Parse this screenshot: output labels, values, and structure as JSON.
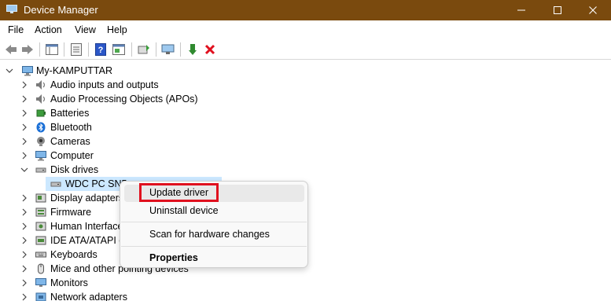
{
  "window": {
    "title": "Device Manager",
    "minimize_glyph": "—",
    "maximize_glyph": "☐",
    "close_glyph": "✕"
  },
  "menu": [
    "File",
    "Action",
    "View",
    "Help"
  ],
  "toolbar": {
    "icons": [
      "back-icon",
      "forward-icon",
      "console-tree-icon",
      "properties-icon",
      "help-icon",
      "action-pane-icon",
      "update-driver-icon",
      "scan-hardware-icon",
      "enable-device-icon",
      "uninstall-device-icon"
    ]
  },
  "tree": {
    "root": "My-KAMPUTTAR",
    "categories": [
      "Audio inputs and outputs",
      "Audio Processing Objects (APOs)",
      "Batteries",
      "Bluetooth",
      "Cameras",
      "Computer",
      "Disk drives"
    ],
    "disk_child": "WDC PC SN5",
    "more_categories": [
      "Display adapters",
      "Firmware",
      "Human Interface",
      "IDE ATA/ATAPI co",
      "Keyboards",
      "Mice and other pointing devices",
      "Monitors",
      "Network adapters"
    ]
  },
  "context_menu": {
    "items": [
      "Update driver",
      "Uninstall device",
      "Scan for hardware changes",
      "Properties"
    ],
    "highlighted": "Update driver"
  },
  "colors": {
    "titlebar": "#7a4a0e",
    "selection": "#cce8ff",
    "highlight_box": "#e0101e"
  }
}
